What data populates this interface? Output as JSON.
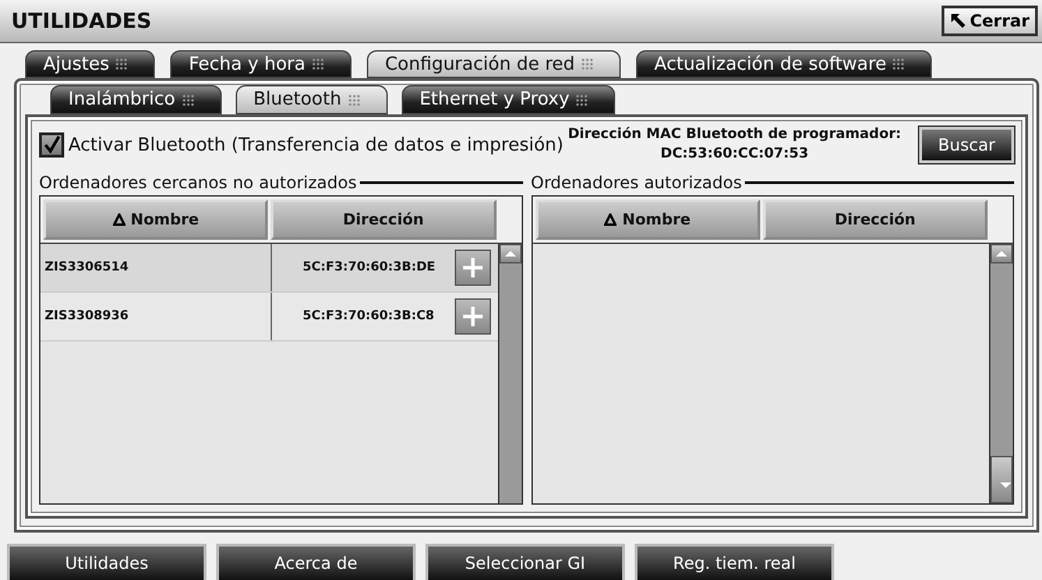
{
  "window": {
    "title": "UTILIDADES",
    "close_button": "Cerrar"
  },
  "tabs": [
    {
      "label": "Ajustes",
      "selected": false
    },
    {
      "label": "Fecha y hora",
      "selected": false
    },
    {
      "label": "Configuración de red",
      "selected": true
    },
    {
      "label": "Actualización de software",
      "selected": false
    }
  ],
  "subtabs": [
    {
      "label": "Inalámbrico",
      "selected": false
    },
    {
      "label": "Bluetooth",
      "selected": true
    },
    {
      "label": "Ethernet y Proxy",
      "selected": false
    }
  ],
  "bluetooth": {
    "label": "Activar Bluetooth (Transferencia de datos e impresión)",
    "checked": true,
    "mac_label": "Dirección MAC Bluetooth de programador:",
    "mac_value": "DC:53:60:CC:07:53",
    "search_button": "Buscar"
  },
  "panels": [
    {
      "title": "Ordenadores cercanos no autorizados",
      "columns": [
        {
          "label": "Nombre",
          "sorted": true
        },
        {
          "label": "Dirección",
          "sorted": false
        }
      ],
      "rows": [
        {
          "name": "ZIS3306514",
          "address": "5C:F3:70:60:3B:DE",
          "selected": true
        },
        {
          "name": "ZIS3308936",
          "address": "5C:F3:70:60:3B:C8",
          "selected": false
        }
      ]
    },
    {
      "title": "Ordenadores autorizados",
      "columns": [
        {
          "label": "Nombre",
          "sorted": true
        },
        {
          "label": "Dirección",
          "sorted": false
        }
      ]
    }
  ],
  "bottom_buttons": [
    "Utilidades",
    "Acerca de",
    "Seleccionar GI",
    "Reg. tiem. real"
  ]
}
